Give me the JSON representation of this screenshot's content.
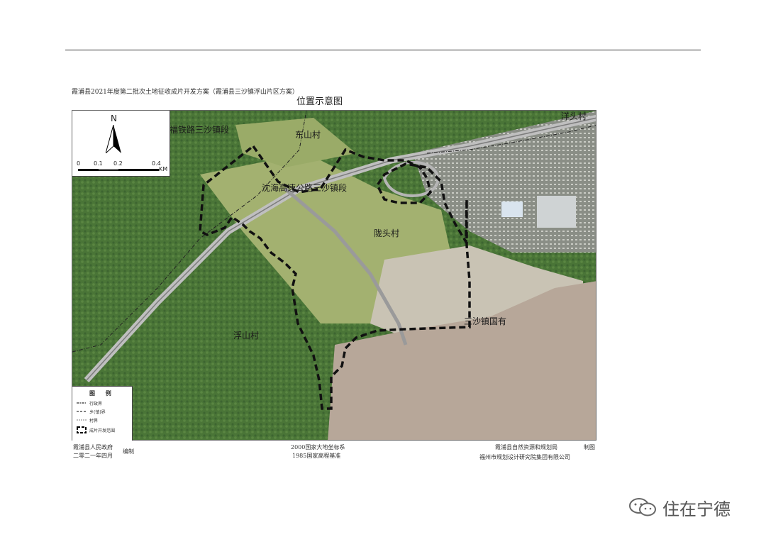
{
  "document": {
    "header": "霞浦县2021年度第二批次土地征收成片开发方案（霞浦县三沙镇浮山片区方案）",
    "map_title": "位置示意图"
  },
  "map": {
    "labels": {
      "dongshan": "东山村",
      "rail": "福铁路三沙镇段",
      "highway": "沈海高速公路三沙镇段",
      "longtou": "陇头村",
      "fushan": "浮山村",
      "sansha_state": "三沙镇国有",
      "yangtou": "洋头村"
    },
    "compass": {
      "north": "N",
      "ticks": [
        "0",
        "0.1",
        "0.2",
        "0.4"
      ],
      "unit": "KM"
    },
    "legend": {
      "title": "图 例",
      "items": [
        "行政界",
        "乡(镇)界",
        "村界",
        "成片开发范围"
      ]
    },
    "colors": {
      "vegetation": "#4f7a3a",
      "farmland": "#9fae6e",
      "sea": "#b8a89a",
      "boundary": "#111111"
    }
  },
  "footer": {
    "left_line1": "霞浦县人民政府",
    "left_line2": "二零二一年四月",
    "left_suffix": "编制",
    "center_line1": "2000国家大地坐标系",
    "center_line2": "1985国家高程基准",
    "right_line1": "霞浦县自然资源和规划局",
    "right_line2": "福州市规划设计研究院集团有限公司",
    "right_suffix": "制图"
  },
  "watermark": {
    "icon": "wechat-icon",
    "text": "住在宁德"
  }
}
